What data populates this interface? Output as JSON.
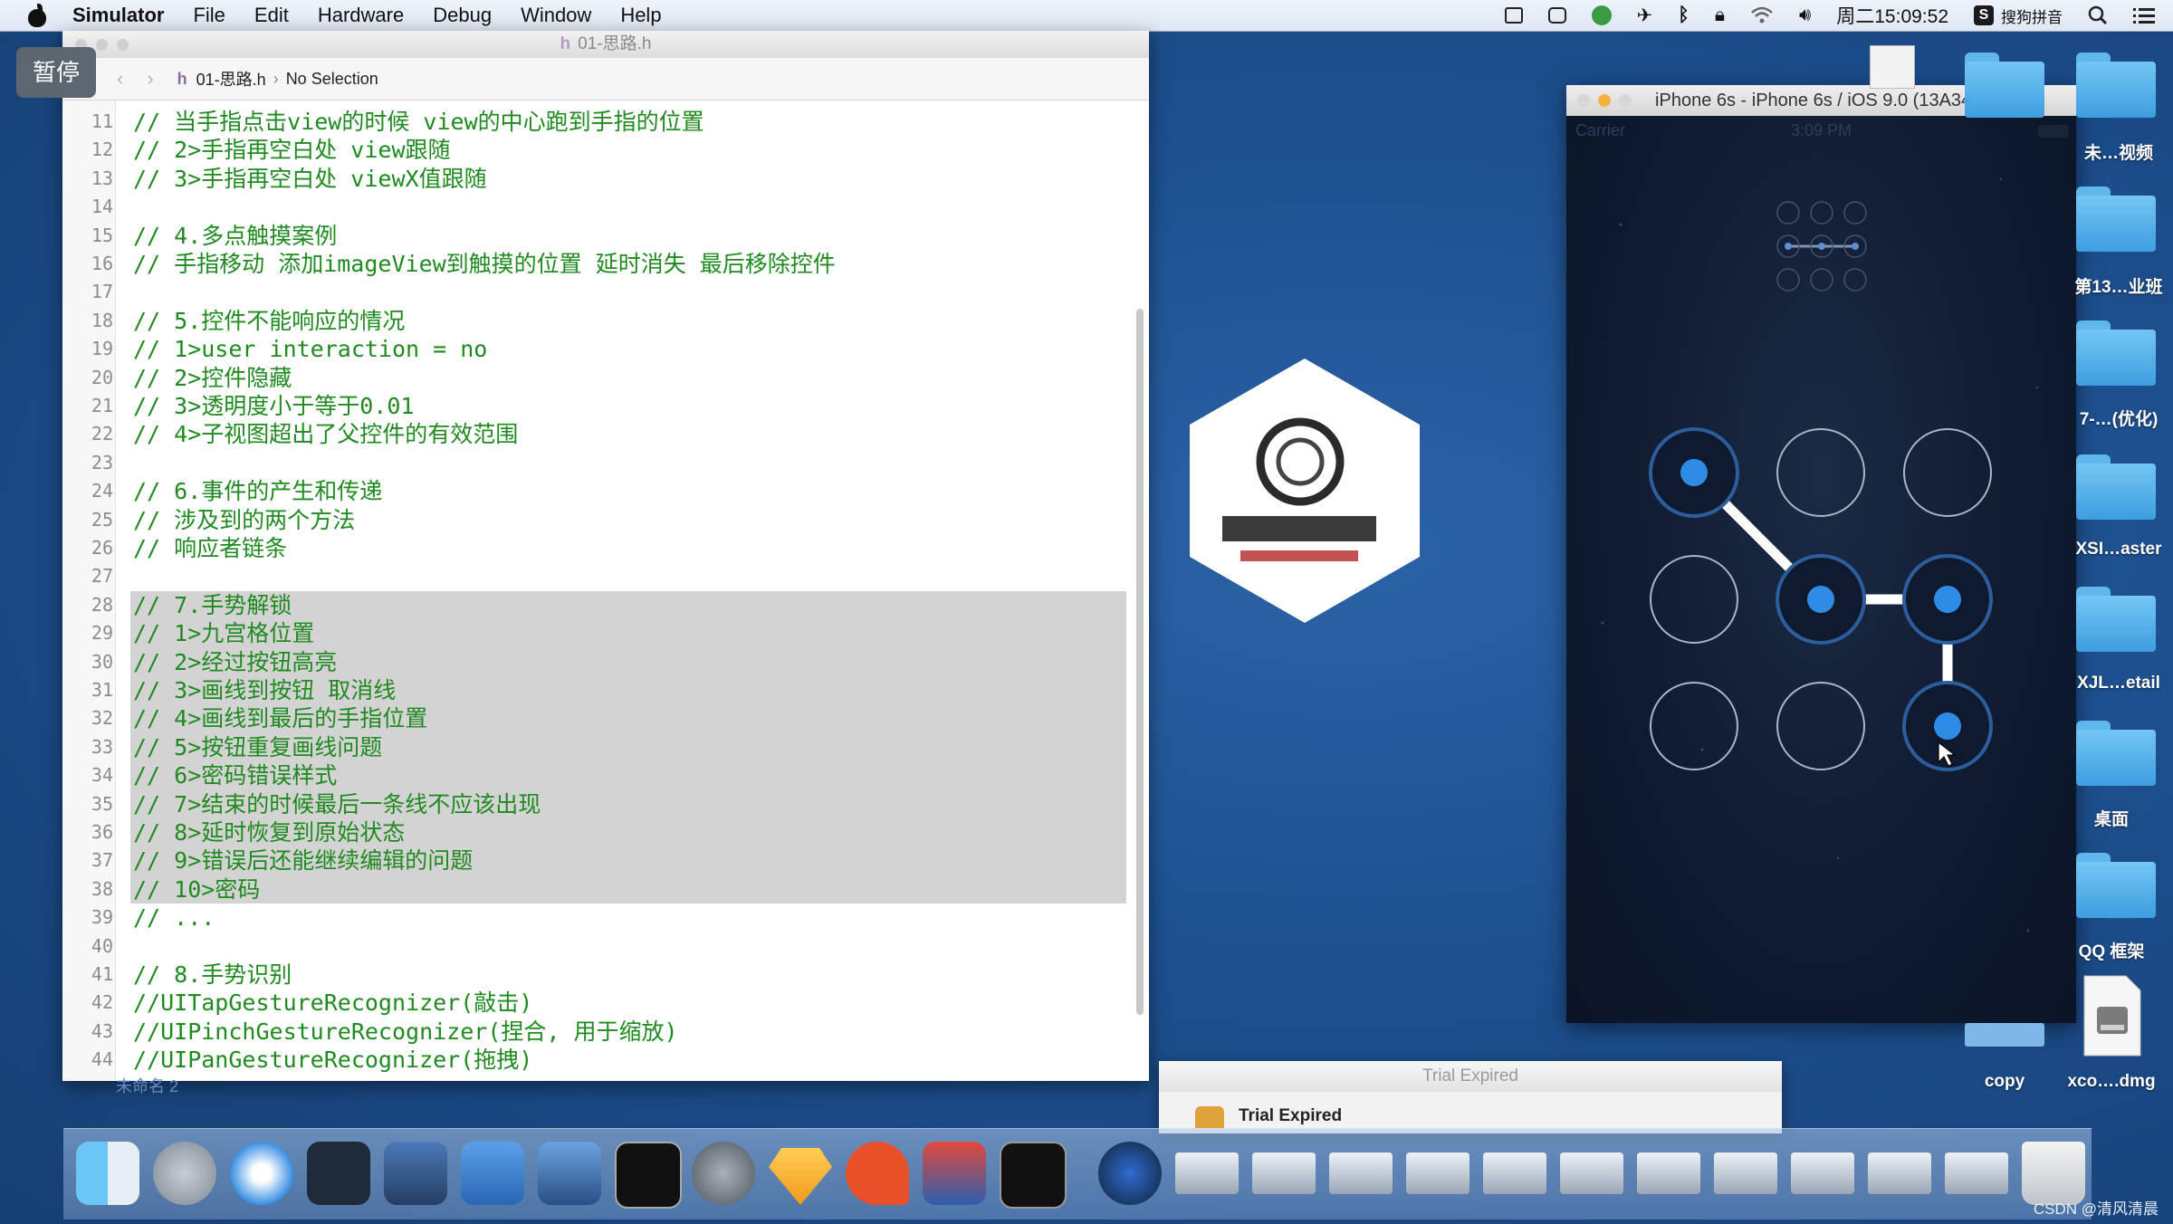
{
  "menubar": {
    "app_name": "Simulator",
    "menus": [
      "File",
      "Edit",
      "Hardware",
      "Debug",
      "Window",
      "Help"
    ],
    "clock": "周二15:09:52",
    "input_method": "搜狗拼音",
    "icons": [
      "screen-mirror-icon",
      "screen-record-icon",
      "green-circle-icon",
      "airplane-icon",
      "bluetooth-icon",
      "lock-icon",
      "wifi-icon",
      "volume-icon",
      "sogou-icon",
      "spotlight-icon",
      "notification-list-icon"
    ]
  },
  "overlay": {
    "pause_label": "暂停"
  },
  "xcode": {
    "window_title": "01-思路.h",
    "breadcrumb_file": "01-思路.h",
    "breadcrumb_selection": "No Selection",
    "code_lines": [
      {
        "n": "11",
        "t": "// 当手指点击view的时候 view的中心跑到手指的位置",
        "hl": false
      },
      {
        "n": "12",
        "t": "// 2>手指再空白处 view跟随",
        "hl": false
      },
      {
        "n": "13",
        "t": "// 3>手指再空白处 viewX值跟随",
        "hl": false
      },
      {
        "n": "14",
        "t": "",
        "hl": false
      },
      {
        "n": "15",
        "t": "// 4.多点触摸案例",
        "hl": false
      },
      {
        "n": "16",
        "t": "// 手指移动 添加imageView到触摸的位置 延时消失 最后移除控件",
        "hl": false
      },
      {
        "n": "17",
        "t": "",
        "hl": false
      },
      {
        "n": "18",
        "t": "// 5.控件不能响应的情况",
        "hl": false
      },
      {
        "n": "19",
        "t": "// 1>user interaction = no",
        "hl": false
      },
      {
        "n": "20",
        "t": "// 2>控件隐藏",
        "hl": false
      },
      {
        "n": "21",
        "t": "// 3>透明度小于等于0.01",
        "hl": false
      },
      {
        "n": "22",
        "t": "// 4>子视图超出了父控件的有效范围",
        "hl": false
      },
      {
        "n": "23",
        "t": "",
        "hl": false
      },
      {
        "n": "24",
        "t": "// 6.事件的产生和传递",
        "hl": false
      },
      {
        "n": "25",
        "t": "// 涉及到的两个方法",
        "hl": false
      },
      {
        "n": "26",
        "t": "// 响应者链条",
        "hl": false
      },
      {
        "n": "27",
        "t": "",
        "hl": false
      },
      {
        "n": "28",
        "t": "// 7.手势解锁",
        "hl": true
      },
      {
        "n": "29",
        "t": "// 1>九宫格位置",
        "hl": true
      },
      {
        "n": "30",
        "t": "// 2>经过按钮高亮",
        "hl": true
      },
      {
        "n": "31",
        "t": "// 3>画线到按钮 取消线",
        "hl": true
      },
      {
        "n": "32",
        "t": "// 4>画线到最后的手指位置",
        "hl": true
      },
      {
        "n": "33",
        "t": "// 5>按钮重复画线问题",
        "hl": true
      },
      {
        "n": "34",
        "t": "// 6>密码错误样式",
        "hl": true
      },
      {
        "n": "35",
        "t": "// 7>结束的时候最后一条线不应该出现",
        "hl": true
      },
      {
        "n": "36",
        "t": "// 8>延时恢复到原始状态",
        "hl": true
      },
      {
        "n": "37",
        "t": "// 9>错误后还能继续编辑的问题",
        "hl": true
      },
      {
        "n": "38",
        "t": "// 10>密码",
        "hl": true
      },
      {
        "n": "39",
        "t": "// ...",
        "hl": false
      },
      {
        "n": "40",
        "t": "",
        "hl": false
      },
      {
        "n": "41",
        "t": "// 8.手势识别",
        "hl": false
      },
      {
        "n": "42",
        "t": "//UITapGestureRecognizer(敲击)",
        "hl": false
      },
      {
        "n": "43",
        "t": "//UIPinchGestureRecognizer(捏合, 用于缩放)",
        "hl": false
      },
      {
        "n": "44",
        "t": "//UIPanGestureRecognizer(拖拽)",
        "hl": false
      }
    ],
    "below_text": "未命名 2"
  },
  "simulator": {
    "window_title": "iPhone 6s - iPhone 6s / iOS 9.0 (13A340)",
    "carrier": "Carrier",
    "time": "3:09 PM",
    "pattern_selected": [
      true,
      false,
      false,
      false,
      true,
      true,
      false,
      false,
      true
    ],
    "preview_selected": [
      false,
      false,
      false,
      true,
      true,
      true,
      false,
      false,
      false
    ]
  },
  "desktop": {
    "icons": [
      {
        "label": "未…视频"
      },
      {
        "label": "第13…业班"
      },
      {
        "label": "7-…(优化)"
      },
      {
        "label": "XSI…aster"
      },
      {
        "label": "XJL…etail"
      },
      {
        "label": "桌面"
      },
      {
        "label": "QQ 框架"
      },
      {
        "label": "copy"
      },
      {
        "label": "xco….dmg"
      }
    ]
  },
  "trial_window": {
    "title": "Trial Expired",
    "message": "Trial Expired"
  },
  "dock": {
    "apps": [
      "finder",
      "launchpad",
      "safari",
      "mouse",
      "photo-slideshow",
      "xcode",
      "instruments",
      "terminal",
      "system-preferences",
      "sketch",
      "wps-presentation",
      "parallels",
      "console",
      "quicktime",
      "window-thumb-1",
      "window-thumb-2",
      "window-thumb-3",
      "window-thumb-4",
      "window-thumb-5",
      "window-thumb-6",
      "window-thumb-7",
      "window-thumb-8",
      "window-thumb-9",
      "window-thumb-10",
      "window-thumb-11",
      "trash"
    ]
  },
  "watermark": "CSDN @清风清晨"
}
